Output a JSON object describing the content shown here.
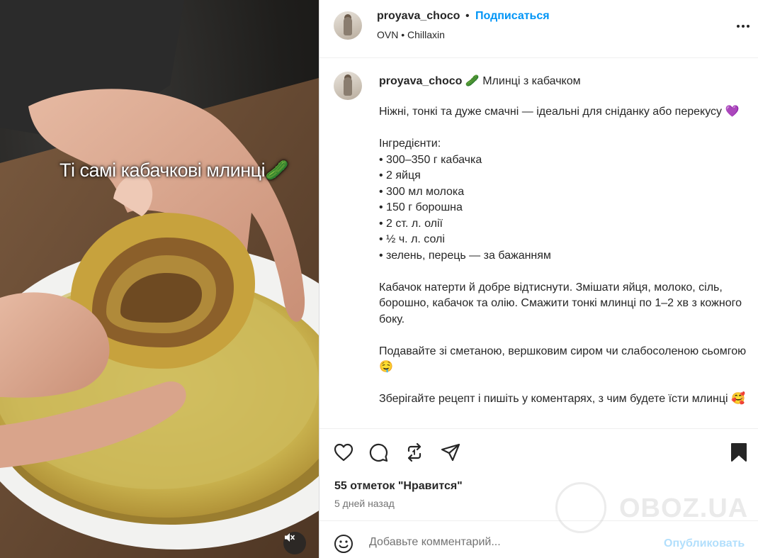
{
  "media": {
    "overlay_text": "Ті самі кабачкові млинці🥒",
    "mute_icon": "speaker-muted-icon"
  },
  "header": {
    "username": "proyava_choco",
    "separator": "•",
    "follow_label": "Подписаться",
    "audio_artist": "OVN",
    "audio_sep": "•",
    "audio_track": "Chillaxin",
    "more_icon": "more-horizontal-icon"
  },
  "caption": {
    "username": "proyava_choco",
    "title": "🥒 Млинці з кабачком",
    "intro": "Ніжні, тонкі та дуже смачні — ідеальні для сніданку або перекусу 💜",
    "ingredients_heading": "Інгредієнти:",
    "ingredients": [
      "• 300–350 г кабачка",
      "• 2 яйця",
      "• 300 мл молока",
      "• 150 г борошна",
      "• 2 ст. л. олії",
      "• ½ ч. л. солі",
      "• зелень, перець — за бажанням"
    ],
    "method": "Кабачок натерти й добре відтиснути. Змішати яйця, молоко, сіль, борошно, кабачок та олію. Смажити тонкі млинці по 1–2 хв з кожного боку.",
    "serving": "Подавайте зі сметаною, вершковим сиром чи слабосоленою сьомгою 🤤",
    "closing": "Зберігайте рецепт і пишіть у коментарях, з чим будете їсти млинці 🥰"
  },
  "actions": {
    "icons": [
      "heart-icon",
      "comment-icon",
      "repost-icon",
      "share-icon",
      "bookmark-icon"
    ],
    "likes": "55 отметок \"Нравится\"",
    "date": "5 дней назад"
  },
  "comment": {
    "placeholder": "Добавьте комментарий...",
    "post_label": "Опубликовать"
  },
  "watermark": {
    "text": "OBOZ.UA"
  }
}
